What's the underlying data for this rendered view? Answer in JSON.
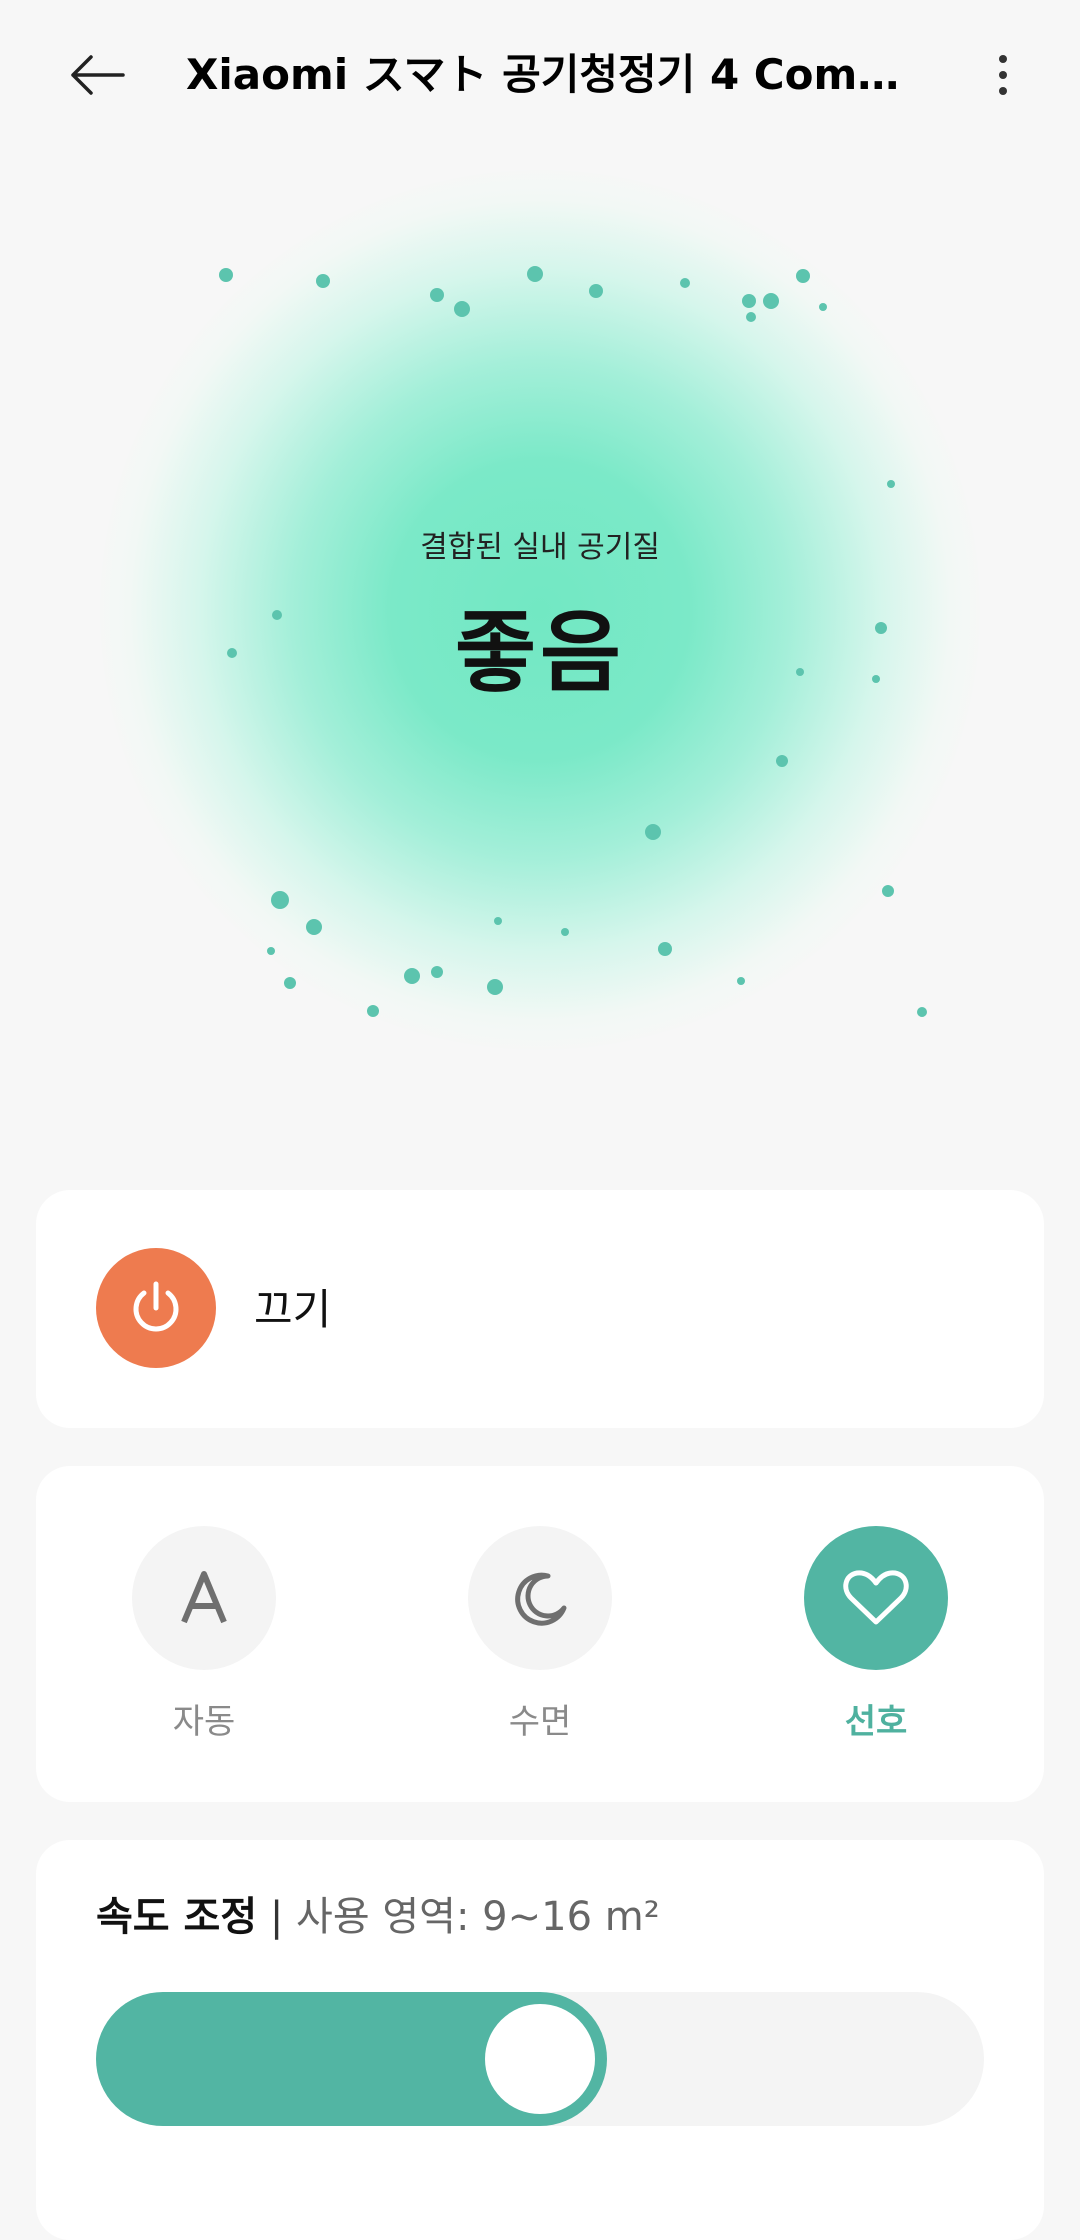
{
  "header": {
    "title": "Xiaomi スマト 공기청정기 4 Com…",
    "back_icon": "back-arrow-icon",
    "more_icon": "more-vertical-icon"
  },
  "air_quality": {
    "label": "결합된 실내 공기질",
    "value": "좋음",
    "glow_color": "#72e8c3",
    "particle_color": "#5cc4ae"
  },
  "power": {
    "label": "끄기",
    "icon": "power-icon",
    "color": "#ee7b4f"
  },
  "modes": [
    {
      "label": "자동",
      "icon": "auto-a-icon",
      "active": false
    },
    {
      "label": "수면",
      "icon": "moon-icon",
      "active": false
    },
    {
      "label": "선호",
      "icon": "heart-icon",
      "active": true
    }
  ],
  "speed": {
    "title": "속도 조정",
    "separator": " | ",
    "area": "사용 영역: 9~16 m²",
    "level_fraction": 0.5,
    "accent": "#52b5a3"
  }
}
